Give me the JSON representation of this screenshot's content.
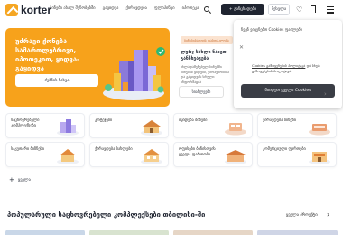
{
  "header": {
    "logo_text": "korter",
    "nav": [
      "ბინები ახალ შენობებში",
      "გაყიდვა",
      "ქირავდება",
      "ფლიპინგი",
      "იპოთეკა"
    ],
    "add_listing_label": "+ განცხადება",
    "signin_label": "შესვლა"
  },
  "hero": {
    "title": "უძრავი ქონება სამართლებრივი, იპოთეკით, ყიდვა-გაყიდვა",
    "button_label": "ძებნის ნახვა",
    "colors": {
      "background": "#f7a21b"
    }
  },
  "promo": {
    "badge": "ბინებისათვის ფასდაკლება",
    "title": "ლურჯ სახლი ნახეთ განსხვავება",
    "description": "ახლადაშენებულ ბინებში ბინების ყიდვის, ქირავნობისა და გაყიდვის სრული ინფორმაცია",
    "button_label": "სიახლეები"
  },
  "cookie": {
    "text1": "ჩვენ ვიყენებთ Cookies ფაილებს",
    "text2_a": "Cookies გამოყენების პოლიტიკა",
    "text2_b": "და სხვა გამოყენების პოლიტიკა",
    "accept_label": "მიიღეთ ყველა Cookies"
  },
  "categories": [
    {
      "label": "საცხოვრებელი კომპლექსები",
      "img": "complex"
    },
    {
      "label": "კოტეჯები",
      "img": "cottage"
    },
    {
      "label": "იყიდება ბინები",
      "img": "apartment"
    },
    {
      "label": "ქირავდება ბინები",
      "img": "rent"
    },
    {
      "label": "საკუთარი ბიზნესი",
      "img": "house"
    },
    {
      "label": "ქირავდება სახლები",
      "img": "cottage2"
    },
    {
      "label": "ოფისები ბინისთვის ყველა ფართობი",
      "img": "office"
    },
    {
      "label": "კომერციული ფართები",
      "img": "commercial"
    }
  ],
  "more_label": "ყველა",
  "section": {
    "title": "პოპულარული საცხოვრებელი კომპლექსები თბილისი-ში",
    "see_all": "ყველა პროექტი"
  }
}
